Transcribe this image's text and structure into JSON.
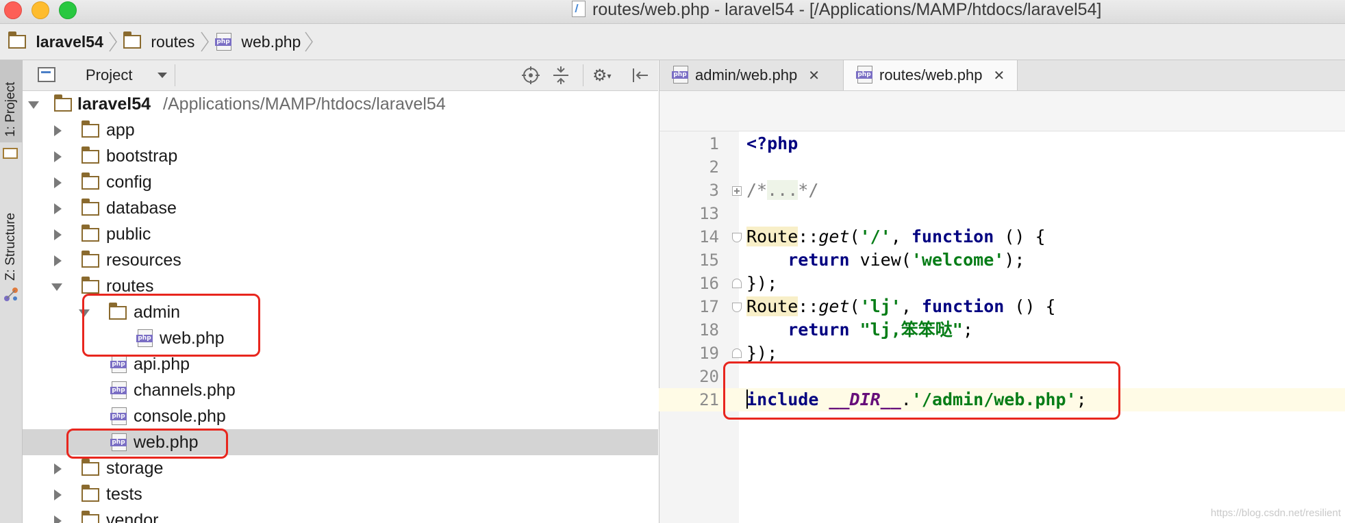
{
  "window": {
    "title": "routes/web.php - laravel54 - [/Applications/MAMP/htdocs/laravel54]"
  },
  "navbar": {
    "crumbs": [
      "laravel54",
      "routes",
      "web.php"
    ]
  },
  "toolstrip": {
    "tabs": [
      "1: Project",
      "Z: Structure"
    ]
  },
  "project_panel": {
    "title": "Project",
    "root": {
      "name": "laravel54",
      "path": "/Applications/MAMP/htdocs/laravel54"
    },
    "items": [
      "app",
      "bootstrap",
      "config",
      "database",
      "public",
      "resources",
      "routes",
      "admin",
      "web.php",
      "api.php",
      "channels.php",
      "console.php",
      "web.php",
      "storage",
      "tests",
      "vendor"
    ]
  },
  "editor": {
    "tabs": [
      {
        "label": "admin/web.php",
        "active": false
      },
      {
        "label": "routes/web.php",
        "active": true
      }
    ],
    "close_glyph": "✕",
    "lines": [
      {
        "n": "1"
      },
      {
        "n": "2"
      },
      {
        "n": "3"
      },
      {
        "n": "13"
      },
      {
        "n": "14"
      },
      {
        "n": "15"
      },
      {
        "n": "16"
      },
      {
        "n": "17"
      },
      {
        "n": "18"
      },
      {
        "n": "19"
      },
      {
        "n": "20"
      },
      {
        "n": "21"
      }
    ],
    "code": {
      "l1_open": "<?php",
      "l3_open": "/*",
      "l3_dots": "...",
      "l3_close": "*/",
      "route_cls": "Route",
      "dcolon": "::",
      "get": "get",
      "l14_arg": "'/'",
      "comma": ", ",
      "function": "function",
      "fn_tail": " () {",
      "indent": "    ",
      "return": "return",
      "l15_rest1": " view(",
      "l15_str": "'welcome'",
      "l15_rest2": ");",
      "closer": "});",
      "l17_arg": "'lj'",
      "l18_str": "\"lj,笨笨哒\"",
      "semi": ";",
      "l21_include_rest": "nclude ",
      "l21_include_i": "i",
      "l21_const": "__DIR__",
      "l21_dot": ".",
      "l21_str": "'/admin/web.php'"
    }
  },
  "watermark": "https://blog.csdn.net/resilient"
}
